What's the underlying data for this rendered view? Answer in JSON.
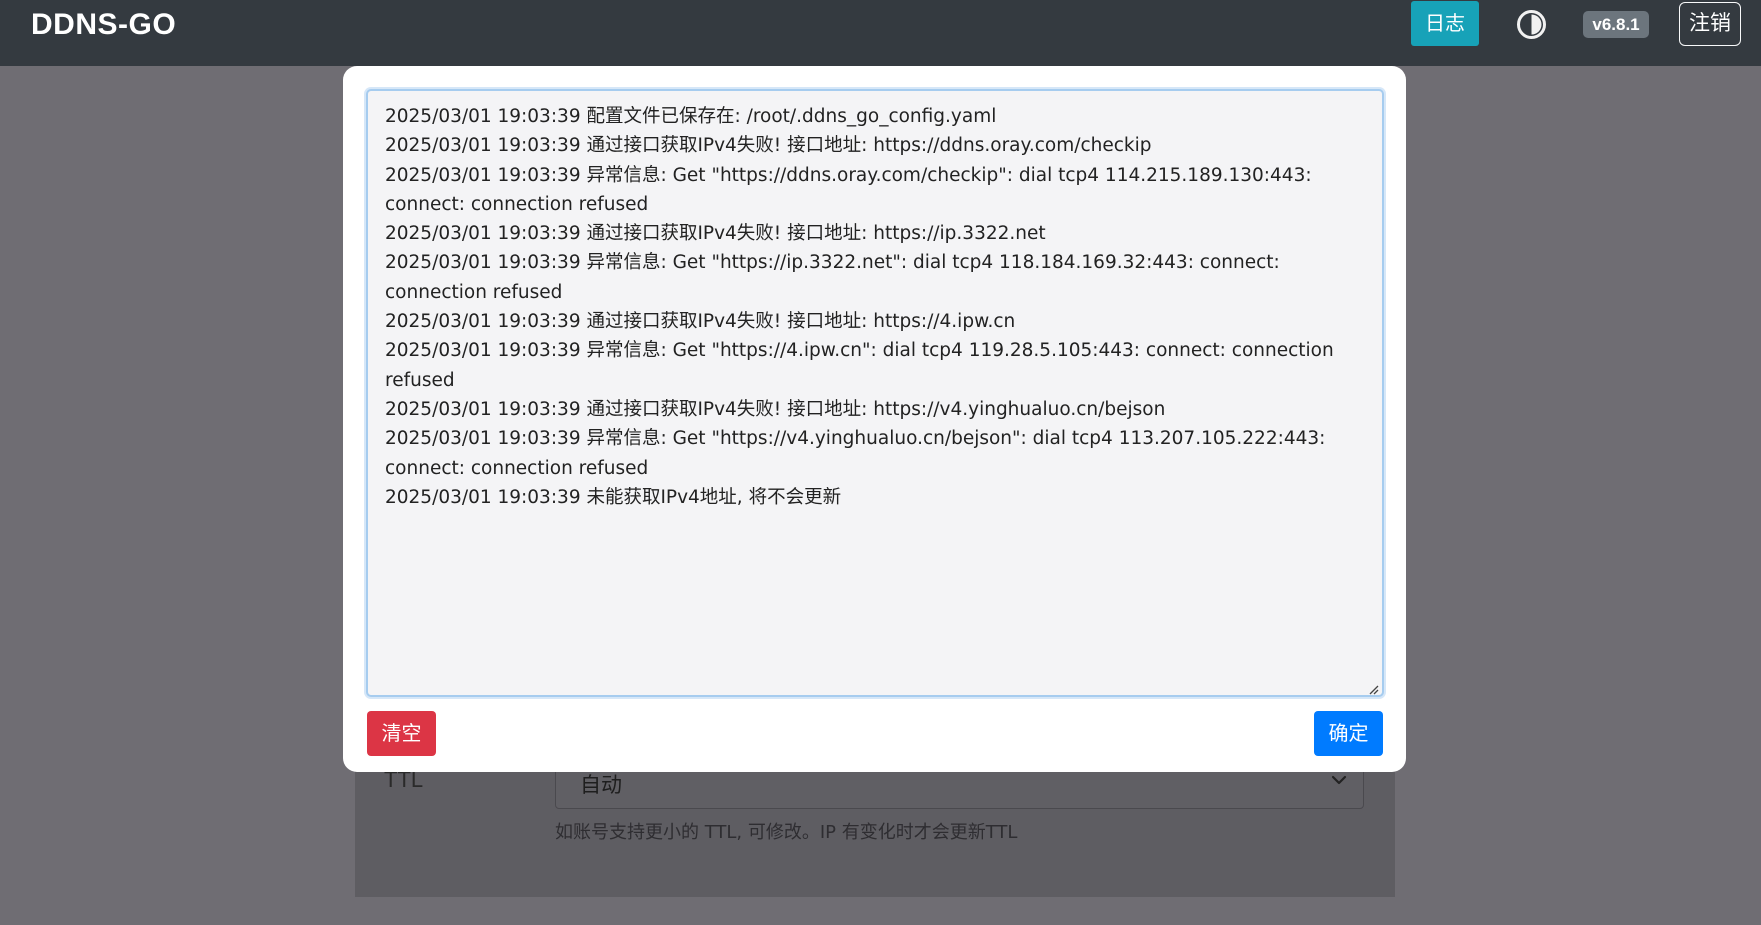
{
  "navbar": {
    "brand": "DDNS-GO",
    "log_label": "日志",
    "theme_icon": "contrast-icon",
    "version": "v6.8.1",
    "logout_label": "注销"
  },
  "background": {
    "ttl_label": "TTL",
    "ttl_value": "自动",
    "ttl_help": "如账号支持更小的 TTL, 可修改。IP 有变化时才会更新TTL"
  },
  "modal": {
    "log_lines": [
      "2025/03/01 19:03:39 配置文件已保存在: /root/.ddns_go_config.yaml",
      "2025/03/01 19:03:39 通过接口获取IPv4失败! 接口地址: https://ddns.oray.com/checkip",
      "2025/03/01 19:03:39 异常信息: Get \"https://ddns.oray.com/checkip\": dial tcp4 114.215.189.130:443: connect: connection refused",
      "2025/03/01 19:03:39 通过接口获取IPv4失败! 接口地址: https://ip.3322.net",
      "2025/03/01 19:03:39 异常信息: Get \"https://ip.3322.net\": dial tcp4 118.184.169.32:443: connect: connection refused",
      "2025/03/01 19:03:39 通过接口获取IPv4失败! 接口地址: https://4.ipw.cn",
      "2025/03/01 19:03:39 异常信息: Get \"https://4.ipw.cn\": dial tcp4 119.28.5.105:443: connect: connection refused",
      "2025/03/01 19:03:39 通过接口获取IPv4失败! 接口地址: https://v4.yinghualuo.cn/bejson",
      "2025/03/01 19:03:39 异常信息: Get \"https://v4.yinghualuo.cn/bejson\": dial tcp4 113.207.105.222:443: connect: connection refused",
      "2025/03/01 19:03:39 未能获取IPv4地址, 将不会更新"
    ],
    "clear_label": "清空",
    "ok_label": "确定"
  },
  "colors": {
    "navbar_bg": "#343a40",
    "info": "#17a2b8",
    "danger": "#dc3545",
    "primary": "#007bff",
    "badge": "#6c757d"
  }
}
